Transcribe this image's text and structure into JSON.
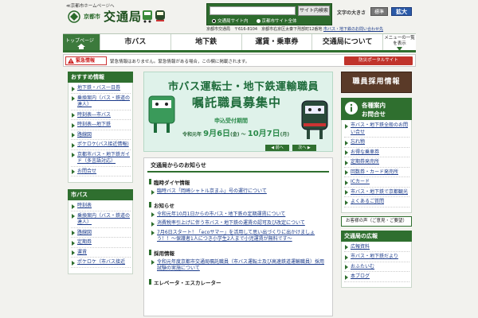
{
  "header": {
    "home_link": "≪京都市ホームページへ",
    "city": "京都市",
    "title": "交通局",
    "search": {
      "placeholder": "",
      "button": "サイト内検索",
      "option_site": "交通局サイト内",
      "option_city": "京都市サイト全体"
    },
    "font_size_label": "文字の大きさ",
    "font_standard": "標準",
    "font_large": "拡大",
    "address": "京都市交通局　〒616-8104　京都市右京区太秦下刑部町12番地",
    "access_link": "市バス・地下鉄のお問い合わせ先"
  },
  "nav": {
    "top": "トップページ",
    "items": [
      "市バス",
      "地下鉄",
      "運賃・乗車券",
      "交通局について"
    ],
    "menu": "メニューの一覧を表示"
  },
  "emergency": {
    "label": "緊急情報",
    "text": "緊急情報はありません。緊急情報がある場合，この欄に掲載されます。",
    "portal": "防災ポータルサイト"
  },
  "left": {
    "sections": [
      {
        "title": "おすすめ情報",
        "items": [
          "地下鉄・バス一日券",
          "乗換案内（バス・鉄道の達人）",
          "時刻表―市バス",
          "時刻表―地下鉄",
          "路線図",
          "ポケロケ(バス接近情報)",
          "京都市バス・地下鉄ガイド（多言語対応）",
          "お問合せ"
        ]
      },
      {
        "title": "市バス",
        "items": [
          "時刻表",
          "乗換案内（バス・鉄道の達人）",
          "路線図",
          "定期券",
          "運賃",
          "ポケロケ（市バス接近"
        ]
      }
    ]
  },
  "banner": {
    "line1": "市バス運転士・地下鉄運輸職員",
    "line2": "嘱託職員募集中",
    "period_label": "申込受付期間",
    "dates_prefix": "令和元年",
    "date_start": "9月6日",
    "date_start_day": "(金)",
    "dates_sep": "～",
    "date_end": "10月7日",
    "date_end_day": "(月)",
    "prev": "◀ 前へ",
    "next": "次へ ▶"
  },
  "news": {
    "title": "交通局からのお知らせ",
    "sections": [
      {
        "heading": "臨時ダイヤ情報",
        "items": [
          "臨時バス「岡崎シャトル京まふ」号の運行について"
        ]
      },
      {
        "heading": "お知らせ",
        "items": [
          "令和元年10月1日からの市バス・地下鉄の定期運賃について",
          "消費税率引上げに伴う市バス・地下鉄の運賃の認可及び改定について",
          "7月6日スタート！「ecoサマー」を活用して思い出づくりに出かけましょう！！～保護者1人につき小学生2人まで小児運賃が無料です～"
        ]
      },
      {
        "heading": "採用情報",
        "items": [
          "令和元年度京都市交通局嘱託職員（市バス運転士及び高速鉄道運輸職員）採用試験の実施について"
        ]
      },
      {
        "heading": "エレベータ・エスカレーター",
        "items": []
      }
    ]
  },
  "right": {
    "recruit": "職員採用情報",
    "contact_title1": "各種案内",
    "contact_title2": "お問合せ",
    "items": [
      "市バス・地下鉄全般のお問い合せ",
      "忘れ物",
      "お得な乗車券",
      "定期券発売所",
      "回数券・カード発売所",
      "ICカード",
      "市バス・地下鉄で京都観光",
      "よくあるご質問"
    ],
    "voice": "お客様の声（ご意見・ご要望）",
    "pr_title": "交通局の広報",
    "pr_items": [
      "広報資料",
      "市バス・地下鉄だより",
      "おふたいむ",
      "本ブログ"
    ]
  }
}
